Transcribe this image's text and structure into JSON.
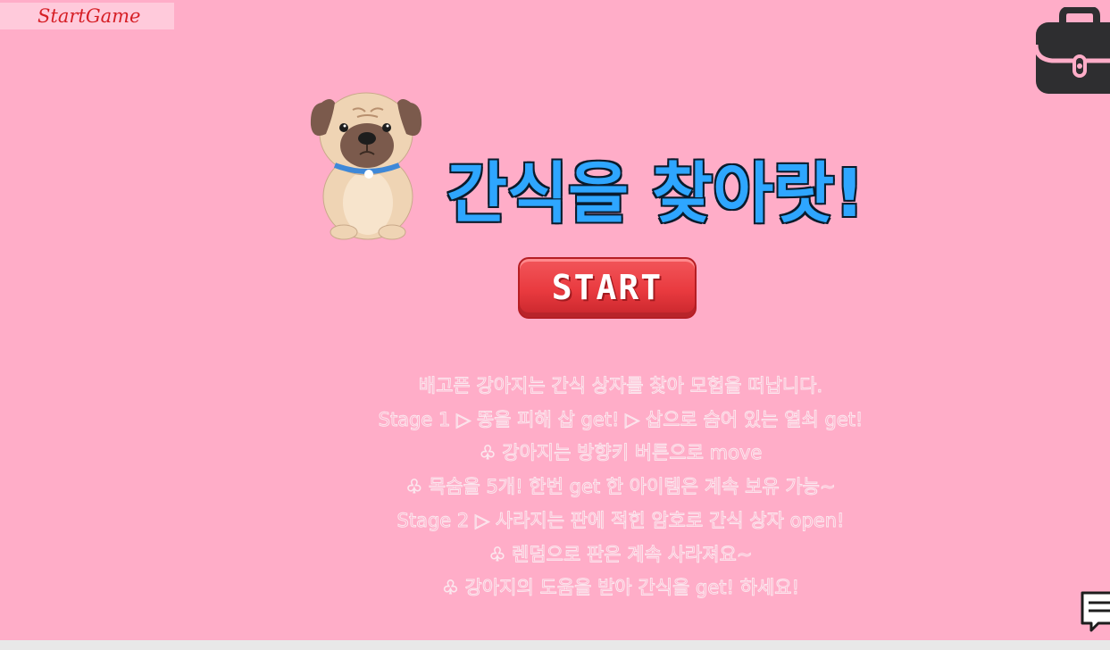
{
  "header": {
    "tab_label": "StartGame"
  },
  "title": "간식을 찾아랏!",
  "start_button": {
    "label": "START"
  },
  "instructions": [
    "배고픈 강아지는 간식 상자를 찾아 모험을 떠납니다.",
    "Stage 1 ▷ 똥을 피해 삽 get! ▷ 삽으로 숨어 있는 열쇠 get!",
    "♧ 강아지는 방향키 버튼으로 move",
    "♧ 목숨을 5개! 한번 get 한 아이템은 계속 보유 가능~",
    "Stage 2 ▷  사라지는 판에 적힌 암호로 간식 상자 open!",
    "♧ 렌덤으로 판은 계속 사라져요~",
    "♧ 강아지의 도움을 받아 간식을 get! 하세요!"
  ],
  "icons": {
    "inventory": "briefcase-icon",
    "chat": "chat-bubble-icon",
    "character": "pug-dog"
  },
  "colors": {
    "background": "#ffadc8",
    "title_fill": "#2ea6ff",
    "start_button": "#e93a3f",
    "tab_text": "#d61f26"
  }
}
